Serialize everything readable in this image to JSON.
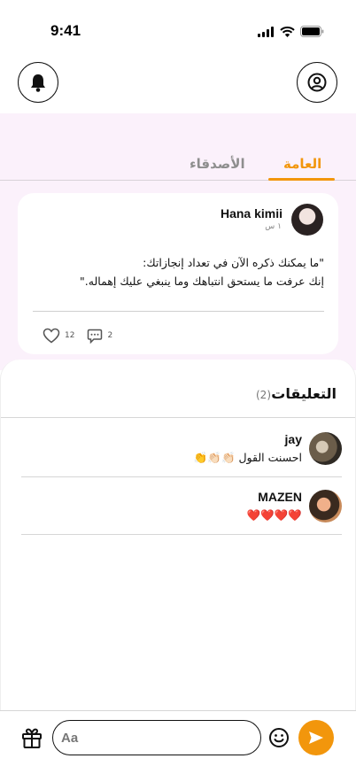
{
  "status_bar": {
    "time": "9:41"
  },
  "tabs": [
    {
      "label": "العامة",
      "active": true
    },
    {
      "label": "الأصدقاء",
      "active": false
    }
  ],
  "post": {
    "author": "Hana kimii",
    "time": "١ س",
    "text_line1": "\"ما يمكنك ذكره الآن في تعداد إنجازاتك:",
    "text_line2": "إنك عرفت ما يستحق انتباهك وما ينبغي عليك إهماله.\"",
    "likes": "12",
    "comments": "2"
  },
  "comments_section": {
    "title": "التعليقات",
    "count": "(2)",
    "items": [
      {
        "name": "jay",
        "text": "احسنت القول 👏🏻👏🏻👏"
      },
      {
        "name": "MAZEN",
        "text": "❤️❤️❤️❤️"
      }
    ]
  },
  "composer": {
    "placeholder": "Aa"
  },
  "colors": {
    "accent": "#f2960c",
    "pink_background": "#fbf1fb"
  }
}
